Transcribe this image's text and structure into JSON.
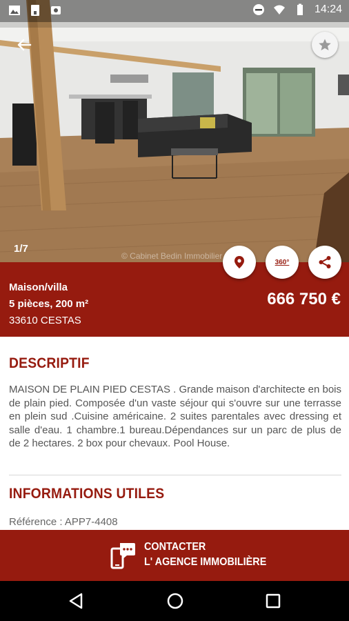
{
  "status_bar": {
    "time": "14:24"
  },
  "gallery": {
    "counter": "1/7",
    "watermark": "© Cabinet Bedin Immobilier"
  },
  "property": {
    "type": "Maison/villa",
    "rooms_area": "5 pièces, 200 m²",
    "location": "33610 CESTAS",
    "price": "666 750 €"
  },
  "actions": {
    "view360_label": "360°"
  },
  "description": {
    "title": "DESCRIPTIF",
    "text": "MAISON DE PLAIN PIED CESTAS . Grande maison d'architecte en bois de plain pied. Composée d'un vaste séjour qui s'ouvre sur une terrasse en plein sud .Cuisine américaine. 2 suites parentales avec dressing et salle d'eau. 1 chambre.1 bureau.Dépendances sur un parc de plus de de 2 hectares. 2 box pour chevaux. Pool House."
  },
  "info": {
    "title": "INFORMATIONS UTILES",
    "reference": "Référence : APP7-4408"
  },
  "contact": {
    "line1": "CONTACTER",
    "line2": "L' AGENCE IMMOBILIÈRE"
  },
  "colors": {
    "brand": "#961b0f",
    "text": "#555555"
  }
}
